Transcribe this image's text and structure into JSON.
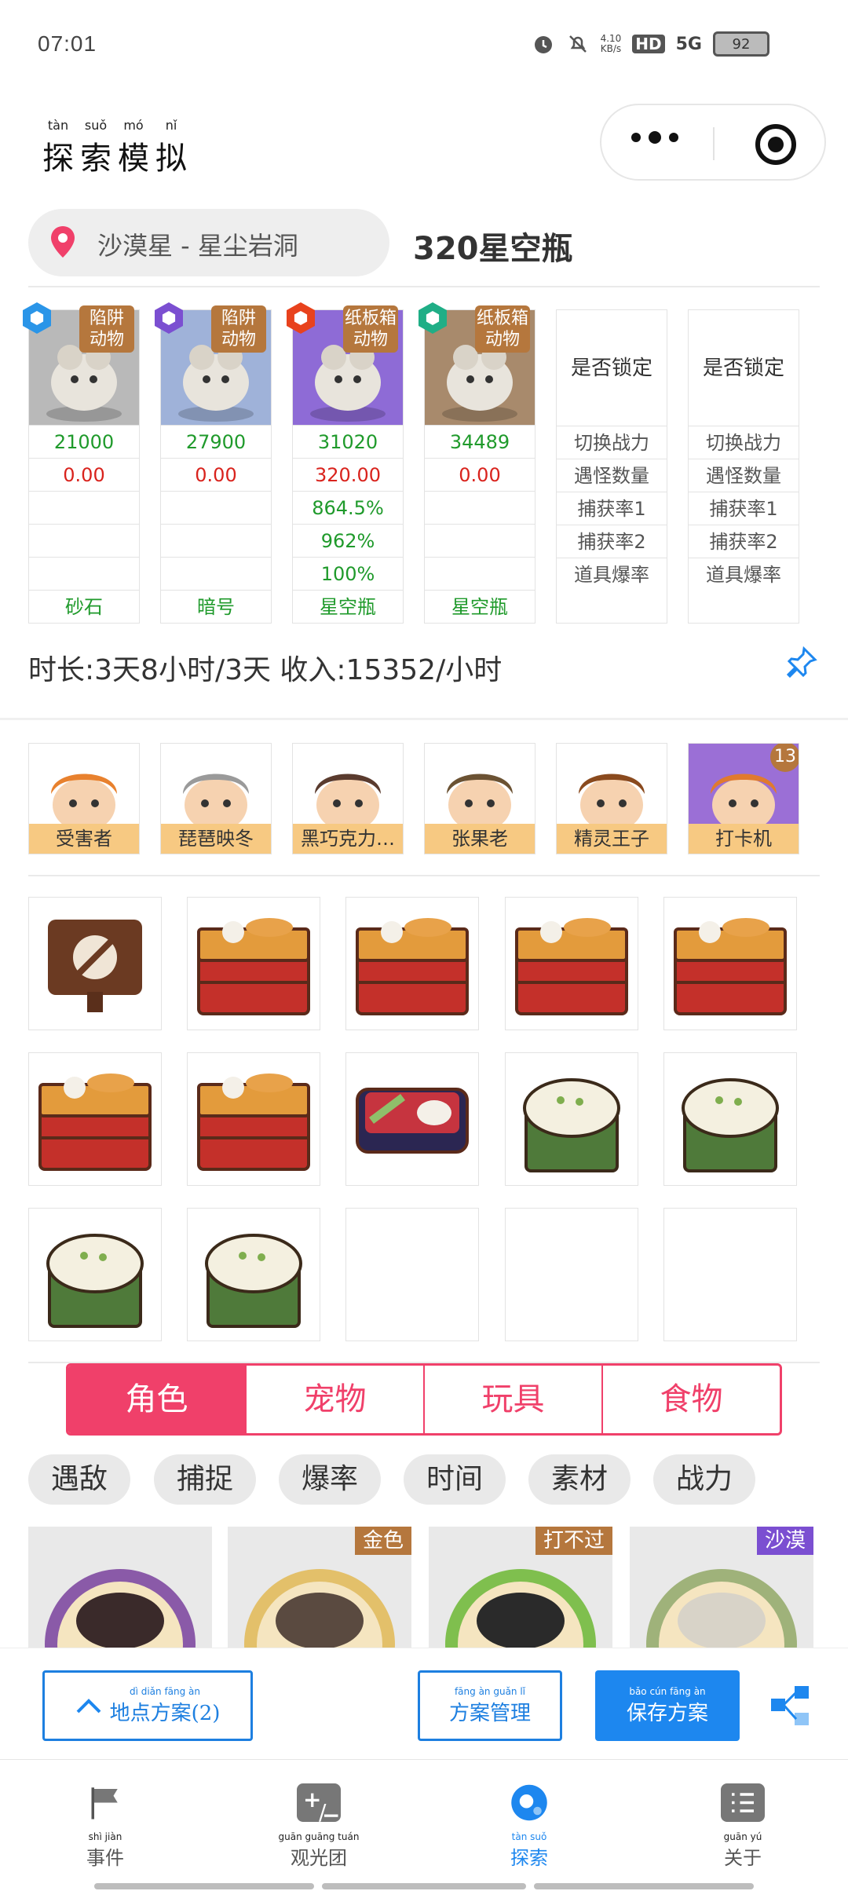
{
  "status_bar": {
    "time": "07:01",
    "net_speed": "4.10\nKB/s",
    "hd": "HD",
    "signal": "5G",
    "battery": "92"
  },
  "header": {
    "title_chars": [
      {
        "py": "tàn",
        "hz": "探"
      },
      {
        "py": "suǒ",
        "hz": "索"
      },
      {
        "py": "mó",
        "hz": "模"
      },
      {
        "py": "nǐ",
        "hz": "拟"
      }
    ]
  },
  "location": {
    "text": "沙漠星 - 星尘岩洞",
    "reward": "320星空瓶"
  },
  "team": [
    {
      "tag": "陷阱\n动物",
      "power": "21000",
      "dmg": "0.00",
      "r1": "",
      "r2": "",
      "r3": "",
      "drop": "砂石",
      "badge_color": "#2a95e8",
      "bg": "#b9b9b9"
    },
    {
      "tag": "陷阱\n动物",
      "power": "27900",
      "dmg": "0.00",
      "r1": "",
      "r2": "",
      "r3": "",
      "drop": "暗号",
      "badge_color": "#7b4fd1",
      "bg": "#9fb2d9"
    },
    {
      "tag": "纸板箱\n动物",
      "power": "31020",
      "dmg": "320.00",
      "r1": "864.5%",
      "r2": "962%",
      "r3": "100%",
      "drop": "星空瓶",
      "badge_color": "#e8421d",
      "bg": "#8e6bd6"
    },
    {
      "tag": "纸板箱\n动物",
      "power": "34489",
      "dmg": "0.00",
      "r1": "",
      "r2": "",
      "r3": "",
      "drop": "星空瓶",
      "badge_color": "#1fae86",
      "bg": "#a88a6c"
    }
  ],
  "lock_cols": [
    {
      "title": "是否锁定",
      "items": [
        "切换战力",
        "遇怪数量",
        "捕获率1",
        "捕获率2",
        "道具爆率"
      ]
    },
    {
      "title": "是否锁定",
      "items": [
        "切换战力",
        "遇怪数量",
        "捕获率1",
        "捕获率2",
        "道具爆率"
      ]
    }
  ],
  "duration_text": "时长:3天8小时/3天 收入:15352/小时",
  "characters": [
    {
      "name": "受害者",
      "hair": "#e8812e",
      "bg": "#ffffff"
    },
    {
      "name": "琵琶映冬",
      "hair": "#9a9a9a",
      "bg": "#ffffff"
    },
    {
      "name": "黑巧克力…",
      "hair": "#5a3b2e",
      "bg": "#ffffff"
    },
    {
      "name": "张果老",
      "hair": "#6b5233",
      "bg": "#ffffff"
    },
    {
      "name": "精灵王子",
      "hair": "#8a4a1e",
      "bg": "#ffffff"
    },
    {
      "name": "打卡机",
      "hair": "#e07a2e",
      "bg": "#9b6fd6",
      "count": "13"
    }
  ],
  "items": [
    [
      "no-food",
      "bento",
      "bento",
      "bento",
      "bento"
    ],
    [
      "bento",
      "bento",
      "bento-box",
      "rice",
      "rice"
    ],
    [
      "rice",
      "rice",
      "",
      "",
      ""
    ]
  ],
  "tabs": [
    "角色",
    "宠物",
    "玩具",
    "食物"
  ],
  "active_tab": 0,
  "filters": [
    "遇敌",
    "捕捉",
    "爆率",
    "时间",
    "素材",
    "战力"
  ],
  "cards": [
    {
      "tag": "",
      "tag_color": ""
    },
    {
      "tag": "金色",
      "tag_color": "#b5773d"
    },
    {
      "tag": "打不过",
      "tag_color": "#b5773d"
    },
    {
      "tag": "沙漠",
      "tag_color": "#7b4fd1"
    }
  ],
  "actions": {
    "location_plan": {
      "py": "dì diǎn fāng àn",
      "label": "地点方案(2)"
    },
    "plan_manage": {
      "py": "fāng àn guǎn lǐ",
      "label": "方案管理"
    },
    "save_plan": {
      "py": "bǎo cún fāng àn",
      "label": "保存方案"
    }
  },
  "nav": [
    {
      "py": "shì jiàn",
      "label": "事件"
    },
    {
      "py": "guān guāng tuán",
      "label": "观光团"
    },
    {
      "py": "tàn suǒ",
      "label": "探索"
    },
    {
      "py": "guān yú",
      "label": "关于"
    }
  ],
  "colors": {
    "accent": "#f0406a",
    "primary": "#1d87ef",
    "tag": "#b5773d",
    "green_text": "#1f9a2b",
    "red_text": "#d9231d"
  }
}
